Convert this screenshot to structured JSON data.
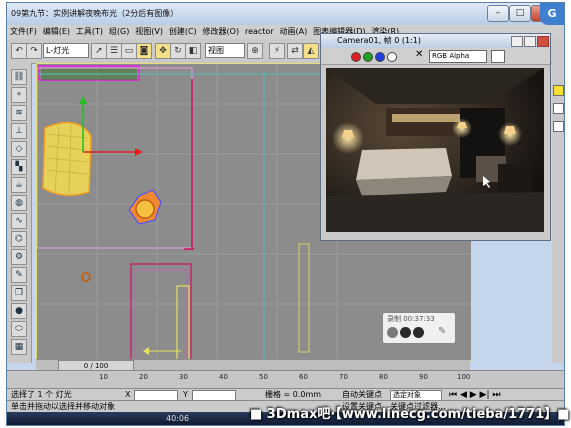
{
  "window": {
    "title": "09第九节：实例讲解夜晚布光（2分后有图像）",
    "minimize": "–",
    "maximize": "□",
    "close": "×",
    "corner_icon": "G"
  },
  "menu": [
    "文件(F)",
    "编辑(E)",
    "工具(T)",
    "组(G)",
    "视图(V)",
    "创建(C)",
    "修改器(O)",
    "reactor",
    "动画(A)",
    "图表编辑器(D)",
    "渲染(R)"
  ],
  "toolbar": {
    "selection_filter": "L-灯光",
    "reference_coord": "视图"
  },
  "viewport": {
    "frame_counter": "0 / 100"
  },
  "render_window": {
    "title": "Camera01, 帧 0 (1:1)",
    "channel": "RGB Alpha",
    "colors": {
      "red": "#e02020",
      "green": "#20a020",
      "blue": "#2040e0"
    }
  },
  "recorder": {
    "label": "录制 00:37:33"
  },
  "timeline": {
    "ticks": [
      "10",
      "20",
      "30",
      "40",
      "50",
      "60",
      "70",
      "80",
      "90",
      "100"
    ]
  },
  "status": {
    "selected": "选择了 1 个 灯光",
    "hint": "单击并拖动以选择并移动对象",
    "x_label": "X",
    "y_label": "Y",
    "grid": "栅格 = 0.0mm",
    "auto_key": "自动关键点",
    "selected_set": "选定对象",
    "set_key": "设置关键点",
    "key_filter": "关键点过滤器..."
  },
  "taskbar": {
    "time": "40:06"
  },
  "watermark": "■ 3Dmax吧·【www.linecg.com/tieba/1771】■"
}
